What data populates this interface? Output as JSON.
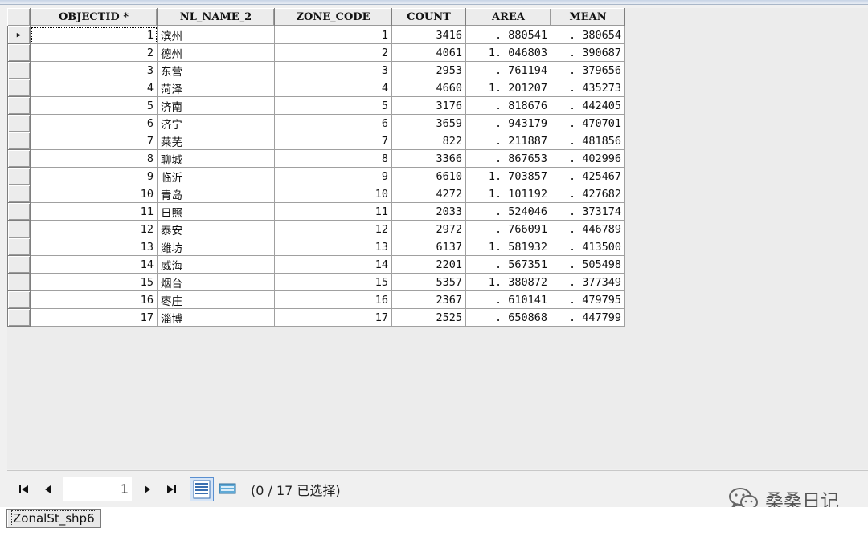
{
  "table": {
    "columns": [
      "OBJECTID *",
      "NL_NAME_2",
      "ZONE_CODE",
      "COUNT",
      "AREA",
      "MEAN"
    ],
    "rows": [
      [
        "1",
        "滨州",
        "1",
        "3416",
        ". 880541",
        ". 380654"
      ],
      [
        "2",
        "德州",
        "2",
        "4061",
        "1. 046803",
        ". 390687"
      ],
      [
        "3",
        "东营",
        "3",
        "2953",
        ". 761194",
        ". 379656"
      ],
      [
        "4",
        "菏泽",
        "4",
        "4660",
        "1. 201207",
        ". 435273"
      ],
      [
        "5",
        "济南",
        "5",
        "3176",
        ". 818676",
        ". 442405"
      ],
      [
        "6",
        "济宁",
        "6",
        "3659",
        ". 943179",
        ". 470701"
      ],
      [
        "7",
        "莱芜",
        "7",
        "822",
        ". 211887",
        ". 481856"
      ],
      [
        "8",
        "聊城",
        "8",
        "3366",
        ". 867653",
        ". 402996"
      ],
      [
        "9",
        "临沂",
        "9",
        "6610",
        "1. 703857",
        ". 425467"
      ],
      [
        "10",
        "青岛",
        "10",
        "4272",
        "1. 101192",
        ". 427682"
      ],
      [
        "11",
        "日照",
        "11",
        "2033",
        ". 524046",
        ". 373174"
      ],
      [
        "12",
        "泰安",
        "12",
        "2972",
        ". 766091",
        ". 446789"
      ],
      [
        "13",
        "潍坊",
        "13",
        "6137",
        "1. 581932",
        ". 413500"
      ],
      [
        "14",
        "威海",
        "14",
        "2201",
        ". 567351",
        ". 505498"
      ],
      [
        "15",
        "烟台",
        "15",
        "5357",
        "1. 380872",
        ". 377349"
      ],
      [
        "16",
        "枣庄",
        "16",
        "2367",
        ". 610141",
        ". 479795"
      ],
      [
        "17",
        "淄博",
        "17",
        "2525",
        ". 650868",
        ". 447799"
      ]
    ],
    "active_row_marker": "▶"
  },
  "nav": {
    "first": "⏮",
    "prev": "◀",
    "page": "1",
    "next": "▶",
    "last": "⏭",
    "status": "(0 / 17 已选择)"
  },
  "watermark": {
    "text": "桑桑日记"
  },
  "tabs": {
    "active": "ZonalSt_shp6"
  }
}
